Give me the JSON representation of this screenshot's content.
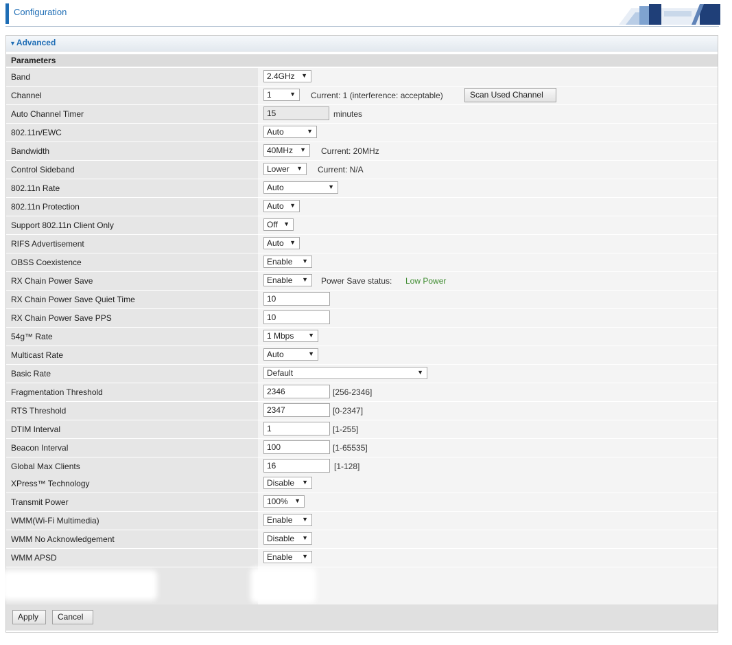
{
  "header": {
    "title": "Configuration",
    "accent": "#1e6db5"
  },
  "section": {
    "title": "Advanced",
    "arrow_icon": "triangle-down-icon"
  },
  "params_title": "Parameters",
  "rows": {
    "band": {
      "label": "Band",
      "value": "2.4GHz"
    },
    "channel": {
      "label": "Channel",
      "value": "1",
      "status": "Current: 1 (interference: acceptable)",
      "scan_button": "Scan Used Channel"
    },
    "auto_channel_timer": {
      "label": "Auto Channel Timer",
      "value": "15",
      "unit": "minutes"
    },
    "ewc": {
      "label": "802.11n/EWC",
      "value": "Auto"
    },
    "bandwidth": {
      "label": "Bandwidth",
      "value": "40MHz",
      "status": "Current: 20MHz"
    },
    "control_sideband": {
      "label": "Control Sideband",
      "value": "Lower",
      "status": "Current: N/A"
    },
    "n_rate": {
      "label": "802.11n Rate",
      "value": "Auto"
    },
    "n_protection": {
      "label": "802.11n Protection",
      "value": "Auto"
    },
    "n_client_only": {
      "label": "Support 802.11n Client Only",
      "value": "Off"
    },
    "rifs": {
      "label": "RIFS Advertisement",
      "value": "Auto"
    },
    "obss": {
      "label": "OBSS Coexistence",
      "value": "Enable"
    },
    "rx_power_save": {
      "label": "RX Chain Power Save",
      "value": "Enable",
      "status_label": "Power Save status:",
      "status_value": "Low Power",
      "status_color": "#3d8b2f"
    },
    "rx_quiet_time": {
      "label": "RX Chain Power Save Quiet Time",
      "value": "10"
    },
    "rx_pps": {
      "label": "RX Chain Power Save PPS",
      "value": "10"
    },
    "g_rate": {
      "label": "54g™ Rate",
      "value": "1 Mbps"
    },
    "multicast_rate": {
      "label": "Multicast Rate",
      "value": "Auto"
    },
    "basic_rate": {
      "label": "Basic Rate",
      "value": "Default"
    },
    "frag_threshold": {
      "label": "Fragmentation Threshold",
      "value": "2346",
      "range": "[256-2346]"
    },
    "rts_threshold": {
      "label": "RTS Threshold",
      "value": "2347",
      "range": "[0-2347]"
    },
    "dtim": {
      "label": "DTIM Interval",
      "value": "1",
      "range": "[1-255]"
    },
    "beacon": {
      "label": "Beacon Interval",
      "value": "100",
      "range": "[1-65535]"
    },
    "max_clients": {
      "label": "Global Max Clients",
      "value": "16",
      "range": "[1-128]"
    },
    "xpress": {
      "label": "XPress™ Technology",
      "value": "Disable"
    },
    "transmit_power": {
      "label": "Transmit Power",
      "value": "100%"
    },
    "wmm": {
      "label": "WMM(Wi-Fi Multimedia)",
      "value": "Enable"
    },
    "wmm_noack": {
      "label": "WMM No Acknowledgement",
      "value": "Disable"
    },
    "wmm_apsd": {
      "label": "WMM APSD",
      "value": "Enable"
    }
  },
  "buttons": {
    "apply": "Apply",
    "cancel": "Cancel"
  },
  "icons": {
    "dropdown": "caret-down-icon",
    "logo": "router-logo-icon"
  }
}
